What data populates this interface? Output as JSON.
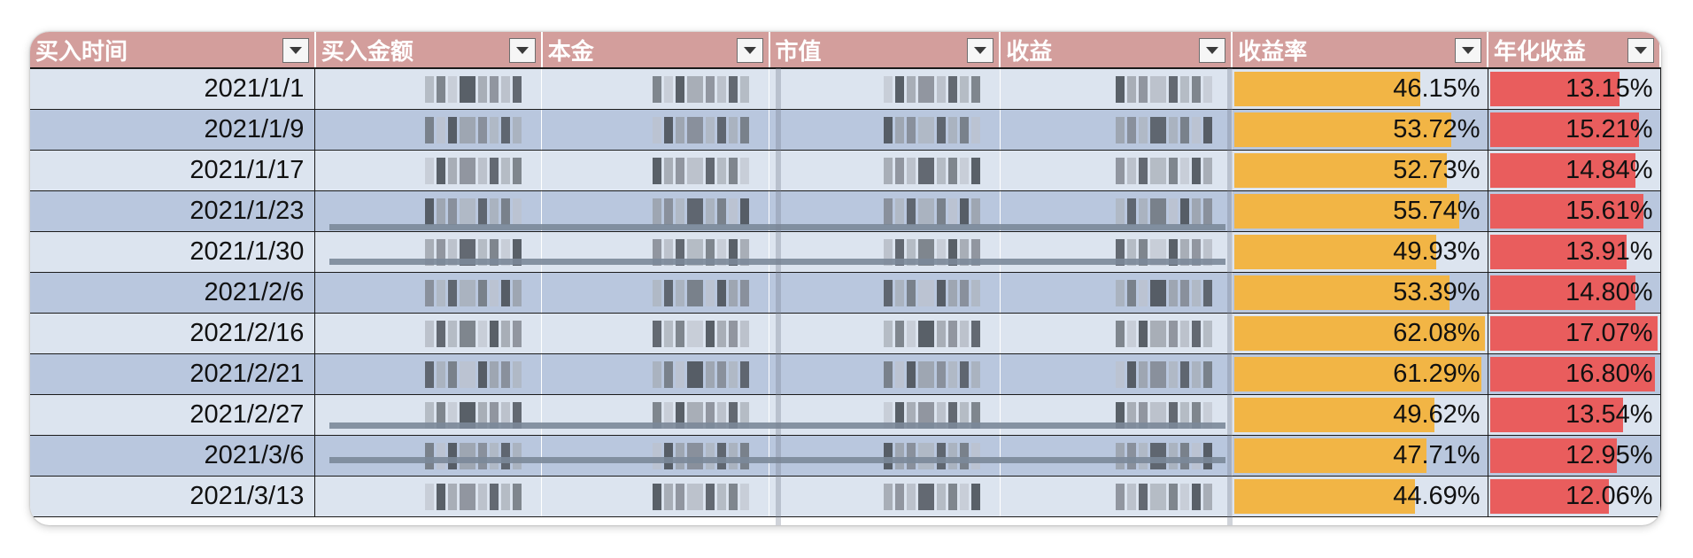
{
  "columns": [
    {
      "label": "买入时间"
    },
    {
      "label": "买入金额"
    },
    {
      "label": "本金"
    },
    {
      "label": "市值"
    },
    {
      "label": "收益"
    },
    {
      "label": "收益率"
    },
    {
      "label": "年化收益"
    }
  ],
  "rows": [
    {
      "date": "2021/1/1",
      "yield": "46.15%",
      "annual": "13.15%"
    },
    {
      "date": "2021/1/9",
      "yield": "53.72%",
      "annual": "15.21%"
    },
    {
      "date": "2021/1/17",
      "yield": "52.73%",
      "annual": "14.84%"
    },
    {
      "date": "2021/1/23",
      "yield": "55.74%",
      "annual": "15.61%"
    },
    {
      "date": "2021/1/30",
      "yield": "49.93%",
      "annual": "13.91%"
    },
    {
      "date": "2021/2/6",
      "yield": "53.39%",
      "annual": "14.80%"
    },
    {
      "date": "2021/2/16",
      "yield": "62.08%",
      "annual": "17.07%"
    },
    {
      "date": "2021/2/21",
      "yield": "61.29%",
      "annual": "16.80%"
    },
    {
      "date": "2021/2/27",
      "yield": "49.62%",
      "annual": "13.54%"
    },
    {
      "date": "2021/3/6",
      "yield": "47.71%",
      "annual": "12.95%"
    },
    {
      "date": "2021/3/13",
      "yield": "44.69%",
      "annual": "12.06%"
    }
  ],
  "colors": {
    "header_bg": "#d39e9c",
    "row_light": "#dce4ef",
    "row_dark": "#b9c7de",
    "yield_bar": "#f2b545",
    "annual_bar": "#e95d5d"
  },
  "notes": {
    "blurred_columns": [
      "买入金额",
      "本金",
      "市值",
      "收益"
    ]
  }
}
